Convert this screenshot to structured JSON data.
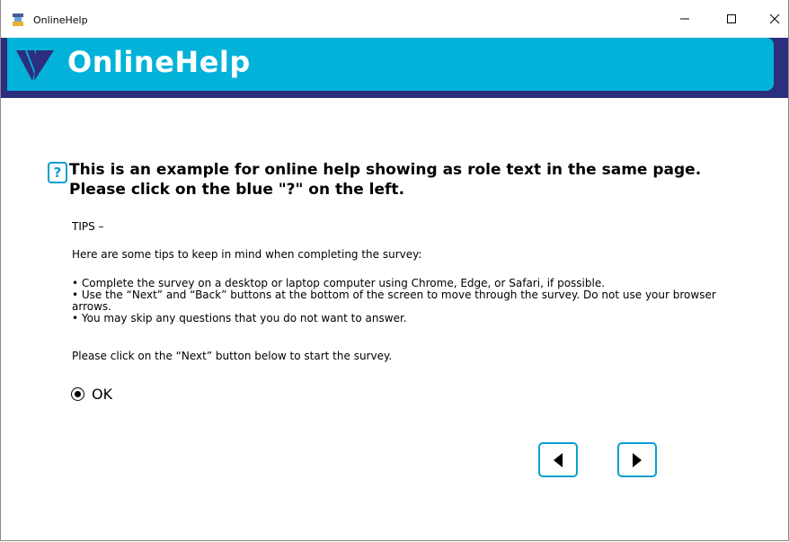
{
  "window": {
    "title": "OnlineHelp",
    "minimize_icon": "minimize-icon",
    "maximize_icon": "maximize-icon",
    "close_icon": "close-icon"
  },
  "header": {
    "brand": "OnlineHelp",
    "logo_icon": "v-logo-icon",
    "banner_color": "#03b2d9",
    "stripe_color": "#2c2e7e"
  },
  "question": {
    "help_label": "?",
    "text": "This is an example for online help showing as role text in the same page. Please click on the blue \"?\" on the left."
  },
  "content": {
    "tips_heading": "TIPS –",
    "intro": "Here are some tips to keep in mind when completing the survey:",
    "bullets": [
      "• Complete the survey on a desktop or laptop computer using Chrome, Edge, or Safari, if possible.",
      "• Use the “Next” and “Back” buttons at the bottom of the screen to move through the survey. Do not use your browser arrows.",
      "• You may skip any questions that you do not want to answer."
    ],
    "start_instruction": "Please click on the “Next” button below to start the survey."
  },
  "answer": {
    "option_label": "OK",
    "selected": true
  },
  "navigation": {
    "back_icon": "triangle-left-icon",
    "next_icon": "triangle-right-icon",
    "accent_color": "#0a9fd0"
  }
}
